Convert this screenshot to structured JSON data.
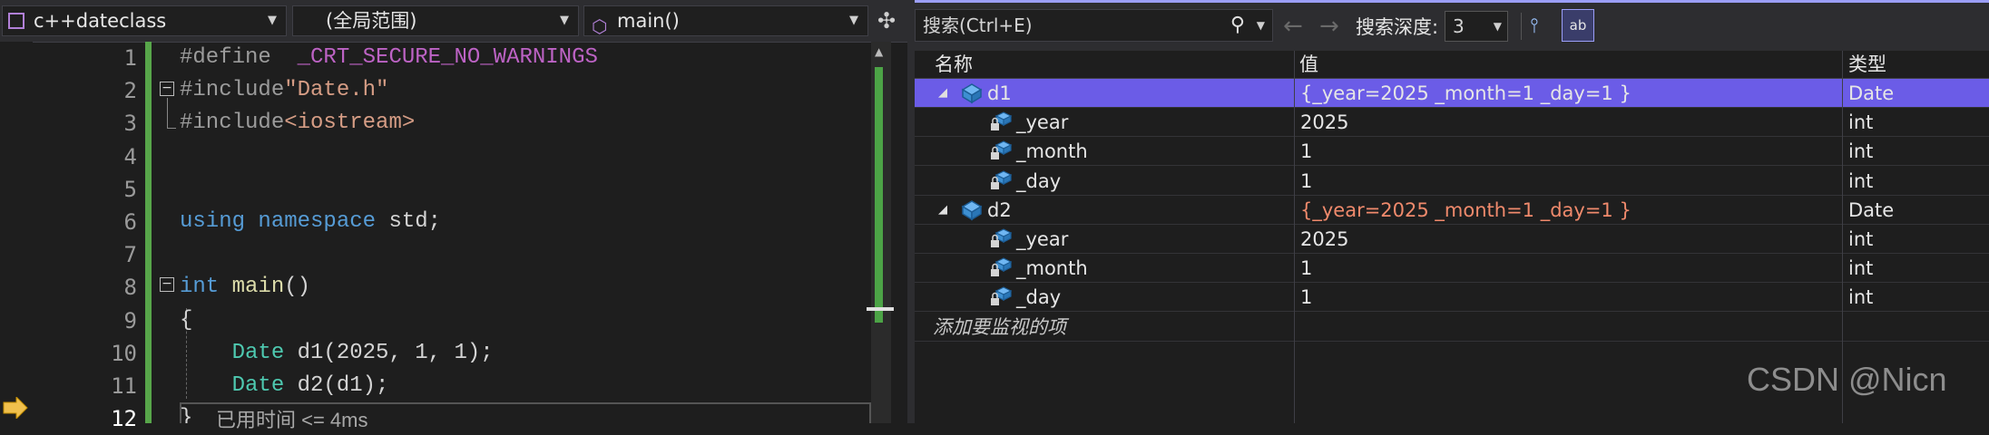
{
  "editor": {
    "project": "c++dateclass",
    "scope": "(全局范围)",
    "function": "main()",
    "line_numbers": [
      "1",
      "2",
      "3",
      "4",
      "5",
      "6",
      "7",
      "8",
      "9",
      "10",
      "11",
      "12"
    ],
    "current_line": "12",
    "lines": [
      [
        {
          "t": "#define  ",
          "c": "pp"
        },
        {
          "t": "_CRT_SECURE_NO_WARNINGS",
          "c": "mac"
        }
      ],
      [
        {
          "t": "#include",
          "c": "pp"
        },
        {
          "t": "\"Date.h\"",
          "c": "str"
        }
      ],
      [
        {
          "t": "#include",
          "c": "pp"
        },
        {
          "t": "<iostream>",
          "c": "str"
        }
      ],
      [],
      [],
      [
        {
          "t": "using ",
          "c": "kw"
        },
        {
          "t": "namespace ",
          "c": "kw"
        },
        {
          "t": "std;",
          "c": "tx"
        }
      ],
      [],
      [
        {
          "t": "int ",
          "c": "kw"
        },
        {
          "t": "main",
          "c": "fn"
        },
        {
          "t": "()",
          "c": "tx"
        }
      ],
      [
        {
          "t": "{",
          "c": "tx"
        }
      ],
      [
        {
          "t": "    Date ",
          "c": "ty"
        },
        {
          "t": "d1(2025, 1, 1);",
          "c": "tx"
        }
      ],
      [
        {
          "t": "    Date ",
          "c": "ty"
        },
        {
          "t": "d2(d1);",
          "c": "tx"
        }
      ],
      [
        {
          "t": "}",
          "c": "tx"
        }
      ]
    ],
    "elapsed_hint": "已用时间 <= 4ms"
  },
  "watch": {
    "search_placeholder": "搜索(Ctrl+E)",
    "depth_label": "搜索深度:",
    "depth_value": "3",
    "columns": {
      "name": "名称",
      "value": "值",
      "type": "类型"
    },
    "rows": [
      {
        "name": "d1",
        "value": "{_year=2025 _month=1 _day=1 }",
        "type": "Date",
        "level": 0,
        "expanded": true,
        "selected": true,
        "changed": false
      },
      {
        "name": "_year",
        "value": "2025",
        "type": "int",
        "level": 1,
        "selected": false,
        "changed": false
      },
      {
        "name": "_month",
        "value": "1",
        "type": "int",
        "level": 1,
        "selected": false,
        "changed": false
      },
      {
        "name": "_day",
        "value": "1",
        "type": "int",
        "level": 1,
        "selected": false,
        "changed": false
      },
      {
        "name": "d2",
        "value": "{_year=2025 _month=1 _day=1 }",
        "type": "Date",
        "level": 0,
        "expanded": true,
        "selected": false,
        "changed": true
      },
      {
        "name": "_year",
        "value": "2025",
        "type": "int",
        "level": 1,
        "selected": false,
        "changed": false
      },
      {
        "name": "_month",
        "value": "1",
        "type": "int",
        "level": 1,
        "selected": false,
        "changed": false
      },
      {
        "name": "_day",
        "value": "1",
        "type": "int",
        "level": 1,
        "selected": false,
        "changed": false
      }
    ],
    "add_item_placeholder": "添加要监视的项"
  },
  "watermark": "CSDN @Nicn",
  "colors": {
    "accent": "#6b5ce7",
    "changed_value": "#f08a6c",
    "change_bar": "#57a64a"
  }
}
